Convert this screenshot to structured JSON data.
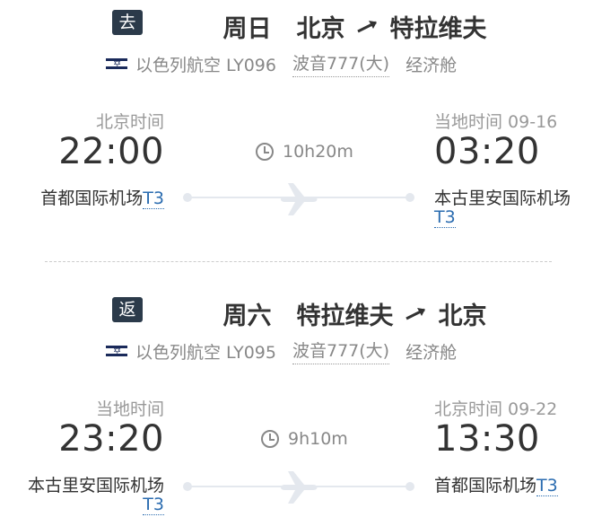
{
  "outbound": {
    "tag": "去",
    "day": "周日",
    "from_city": "北京",
    "to_city": "特拉维夫",
    "airline": "以色列航空 LY096",
    "aircraft": "波音777(大)",
    "cabin": "经济舱",
    "dep_label": "北京时间",
    "dep_time": "22:00",
    "dep_airport": "首都国际机场",
    "dep_terminal": "T3",
    "duration": "10h20m",
    "arr_label": "当地时间 09-16",
    "arr_time": "03:20",
    "arr_airport": "本古里安国际机场",
    "arr_terminal": "T3"
  },
  "return": {
    "tag": "返",
    "day": "周六",
    "from_city": "特拉维夫",
    "to_city": "北京",
    "airline": "以色列航空 LY095",
    "aircraft": "波音777(大)",
    "cabin": "经济舱",
    "dep_label": "当地时间",
    "dep_time": "23:20",
    "dep_airport": "本古里安国际机场",
    "dep_terminal": "T3",
    "duration": "9h10m",
    "arr_label": "北京时间 09-22",
    "arr_time": "13:30",
    "arr_airport": "首都国际机场",
    "arr_terminal": "T3"
  },
  "icons": {
    "route_arrow": "arrow-right-icon",
    "clock": "clock-icon",
    "plane": "plane-icon",
    "airline_logo": "el-al-logo"
  },
  "colors": {
    "tag_bg": "#2b3a4a",
    "terminal_link": "#2b6cb0",
    "track": "#e4e8ee"
  }
}
